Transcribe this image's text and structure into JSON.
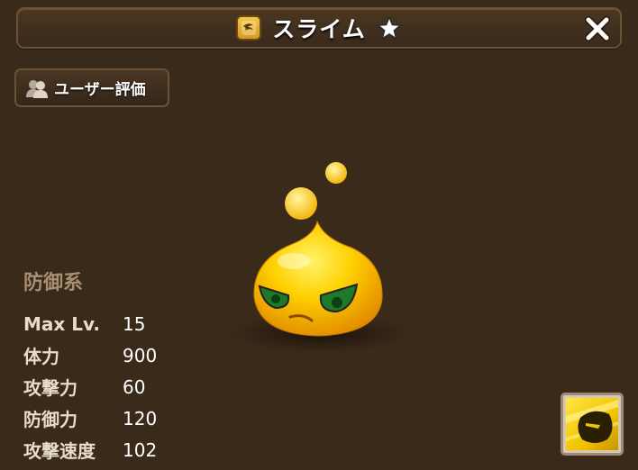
{
  "header": {
    "title": "スライム",
    "element": "wind",
    "element_icon": "wind-element-icon",
    "close_icon": "close-icon"
  },
  "user_review_button": {
    "label": "ユーザー評価",
    "icon": "users-icon"
  },
  "monster": {
    "type": "防御系",
    "stats": [
      {
        "label": "Max Lv.",
        "value": "15"
      },
      {
        "label": "体力",
        "value": "900"
      },
      {
        "label": "攻撃力",
        "value": "60"
      },
      {
        "label": "防御力",
        "value": "120"
      },
      {
        "label": "攻撃速度",
        "value": "102"
      }
    ],
    "star_rating": 1
  },
  "skill": {
    "icon": "skill-icon"
  },
  "colors": {
    "background": "#3a2a1a",
    "panel_border": "#6a5236",
    "category_text": "#a88e73",
    "slime_yellow": "#f5c400"
  }
}
